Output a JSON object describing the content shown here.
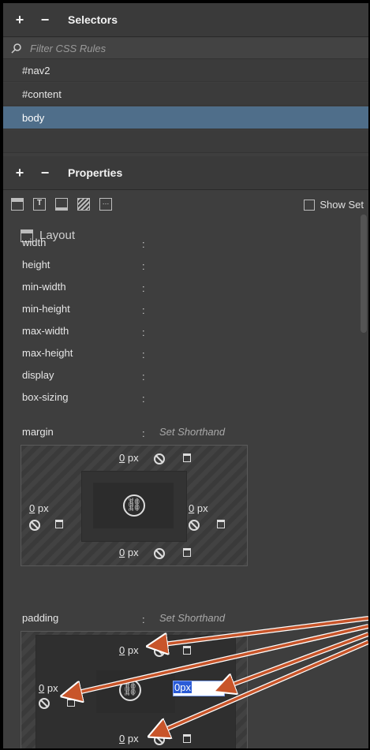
{
  "selectors_panel": {
    "add": "+",
    "remove": "−",
    "title": "Selectors",
    "filter_placeholder": "Filter CSS Rules",
    "items": [
      "#nav2",
      "#content",
      "body"
    ],
    "selected": "body"
  },
  "properties_panel": {
    "add": "+",
    "remove": "−",
    "title": "Properties",
    "show_set_label": "Show Set",
    "toolbar_icons": [
      "layout-icon",
      "text-icon",
      "border-icon",
      "background-icon",
      "more-icon"
    ]
  },
  "layout": {
    "heading": "Layout",
    "properties": [
      {
        "name": "width",
        "colon": ":"
      },
      {
        "name": "height",
        "colon": ":"
      },
      {
        "name": "min-width",
        "colon": ":"
      },
      {
        "name": "min-height",
        "colon": ":"
      },
      {
        "name": "max-width",
        "colon": ":"
      },
      {
        "name": "max-height",
        "colon": ":"
      },
      {
        "name": "display",
        "colon": ":"
      },
      {
        "name": "box-sizing",
        "colon": ":"
      }
    ],
    "margin": {
      "label": "margin",
      "colon": ":",
      "shorthand": "Set Shorthand",
      "top": {
        "value": "0",
        "unit": "px"
      },
      "left": {
        "value": "0",
        "unit": "px"
      },
      "right": {
        "value": "0",
        "unit": "px"
      },
      "bottom": {
        "value": "0",
        "unit": "px"
      }
    },
    "padding": {
      "label": "padding",
      "colon": ":",
      "shorthand": "Set Shorthand",
      "top": {
        "value": "0",
        "unit": "px"
      },
      "left": {
        "value": "0",
        "unit": "px"
      },
      "right_editing": "0px",
      "bottom": {
        "value": "0",
        "unit": "px"
      }
    }
  },
  "colors": {
    "panel_bg": "#3e3e3e",
    "selected_row": "#4f6e8a",
    "annotation_arrow": "#c8552a"
  }
}
